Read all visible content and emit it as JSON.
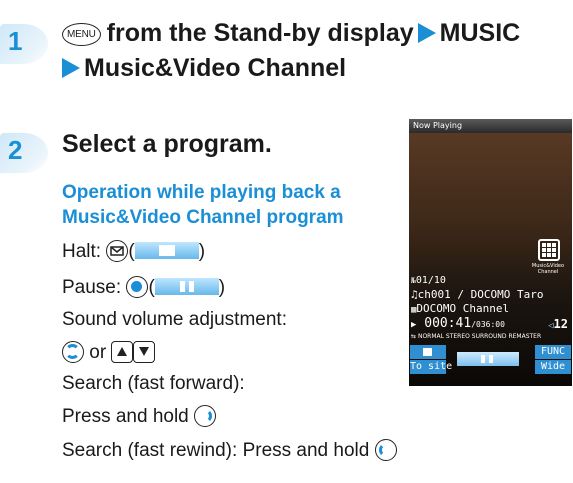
{
  "step1": {
    "number": "1",
    "menu_key": "MENU",
    "line1_text": "from the Stand-by display",
    "line1_target": "MUSIC",
    "line2_target": "Music&Video Channel"
  },
  "step2": {
    "number": "2",
    "title": "Select a program.",
    "sub_heading_line1": "Operation while playing back a",
    "sub_heading_line2": "Music&Video Channel program",
    "halt_label": "Halt:",
    "pause_label": "Pause:",
    "volume_label": "Sound volume adjustment:",
    "or_text": "or",
    "search_ff_label": "Search (fast forward):",
    "press_hold_text": "Press and hold",
    "search_rw_text": "Search (fast rewind): Press and hold"
  },
  "phone": {
    "header": "Now Playing",
    "logo_caption": "Music&Video Channel",
    "track_count": "01/10",
    "program_line": "ch001 / DOCOMO Taro",
    "channel_line": "DOCOMO Channel",
    "time_current": "000:41",
    "time_total": "/036:00",
    "volume": "12",
    "modes": [
      "NORMAL",
      "STEREO",
      "SURROUND",
      "REMASTER"
    ],
    "soft_left": "To site",
    "soft_right_top": "FUNC",
    "soft_right_bottom": "Wide"
  },
  "colors": {
    "accent": "#1a8fd6",
    "softkey": "#2f8fd0"
  },
  "icons": [
    "mail-key-icon",
    "center-key-icon",
    "up-down-key-icon",
    "stop-icon",
    "pause-icon",
    "play-icon",
    "repeat-icon",
    "note-icon"
  ]
}
